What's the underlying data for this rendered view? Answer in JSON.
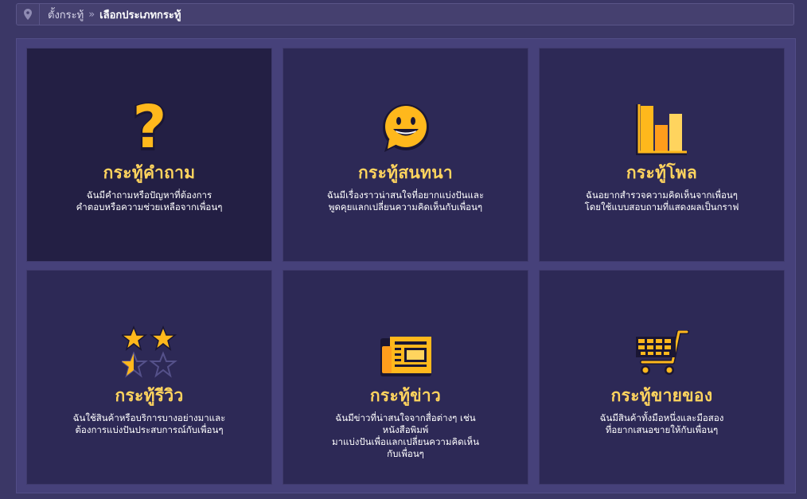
{
  "breadcrumb": {
    "home": "ตั้งกระทู้",
    "separator": "»",
    "current": "เลือกประเภทกระทู้"
  },
  "colors": {
    "accent": "#ffd45e",
    "card_bg": "#2d2956",
    "card_active_bg": "#231f44",
    "page_bg": "#3b3766"
  },
  "cards": [
    {
      "icon": "question-icon",
      "title": "กระทู้คำถาม",
      "desc_line1": "ฉันมีคำถามหรือปัญหาที่ต้องการ",
      "desc_line2": "คำตอบหรือความช่วยเหลือจากเพื่อนๆ",
      "desc_line3": "",
      "desc_line4": ""
    },
    {
      "icon": "smiley-chat-icon",
      "title": "กระทู้สนทนา",
      "desc_line1": "ฉันมีเรื่องราวน่าสนใจที่อยากแบ่งปันและ",
      "desc_line2": "พูดคุยแลกเปลี่ยนความคิดเห็นกับเพื่อนๆ",
      "desc_line3": "",
      "desc_line4": ""
    },
    {
      "icon": "bar-chart-icon",
      "title": "กระทู้โพล",
      "desc_line1": "ฉันอยากสำรวจความคิดเห็นจากเพื่อนๆ",
      "desc_line2": "โดยใช้แบบสอบถามที่แสดงผลเป็นกราฟ",
      "desc_line3": "",
      "desc_line4": ""
    },
    {
      "icon": "stars-rating-icon",
      "title": "กระทู้รีวิว",
      "desc_line1": "ฉันใช้สินค้าหรือบริการบางอย่างมาและ",
      "desc_line2": "ต้องการแบ่งปันประสบการณ์กับเพื่อนๆ",
      "desc_line3": "",
      "desc_line4": ""
    },
    {
      "icon": "newspaper-icon",
      "title": "กระทู้ข่าว",
      "desc_line1": "ฉันมีข่าวที่น่าสนใจจากสื่อต่างๆ เช่น",
      "desc_line2": "หนังสือพิมพ์",
      "desc_line3": "มาแบ่งปันเพื่อแลกเปลี่ยนความคิดเห็น",
      "desc_line4": "กับเพื่อนๆ"
    },
    {
      "icon": "shopping-cart-icon",
      "title": "กระทู้ขายของ",
      "desc_line1": "ฉันมีสินค้าทั้งมือหนึ่งและมือสอง",
      "desc_line2": "ที่อยากเสนอขายให้กับเพื่อนๆ",
      "desc_line3": "",
      "desc_line4": ""
    }
  ]
}
